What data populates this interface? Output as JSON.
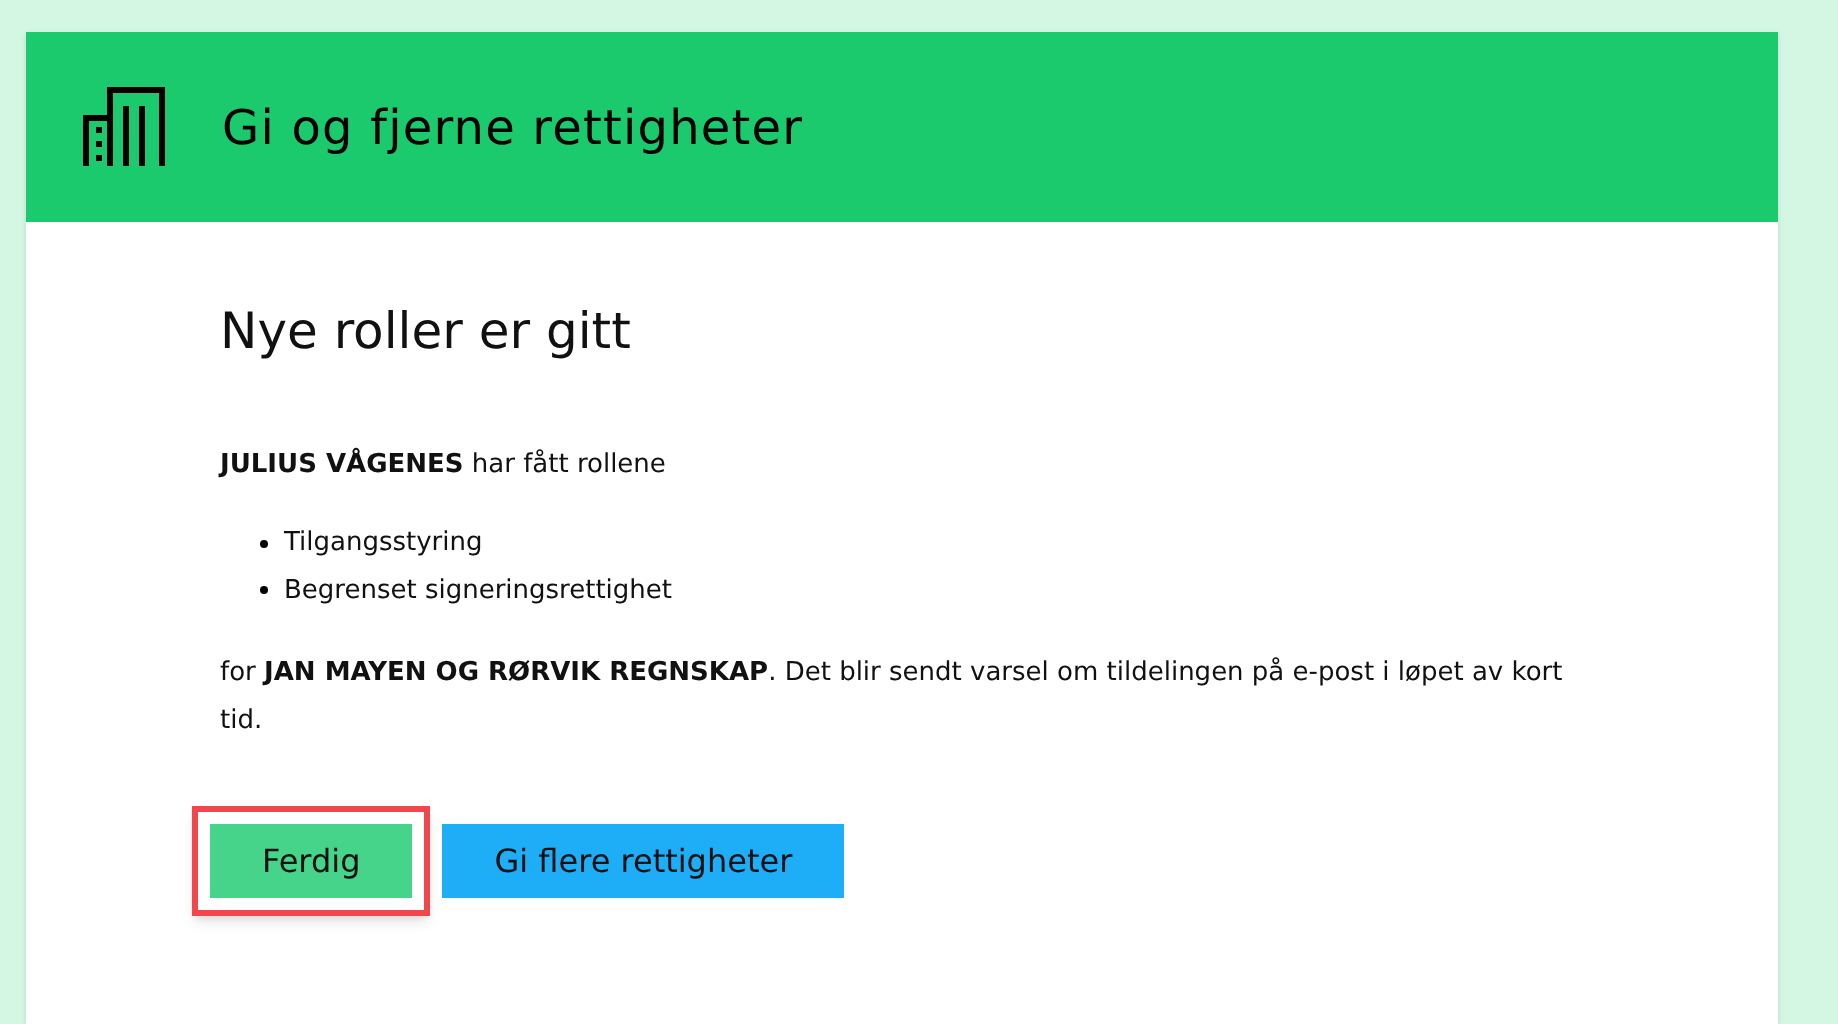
{
  "header": {
    "title": "Gi og fjerne rettigheter"
  },
  "heading": "Nye roller er gitt",
  "intro": "**JULIUS VÅGENES** har fått rollene",
  "roles": [
    "Tilgangsstyring",
    "Begrenset signeringsrettighet"
  ],
  "note": "for **JAN MAYEN OG RØRVIK REGNSKAP**. Det blir sendt varsel om tildelingen på e-post i løpet av kort tid.",
  "buttons": [
    {
      "label": "Ferdig",
      "kind": "done",
      "highlighted": true
    },
    {
      "label": "Gi flere rettigheter",
      "kind": "more",
      "highlighted": false
    }
  ]
}
